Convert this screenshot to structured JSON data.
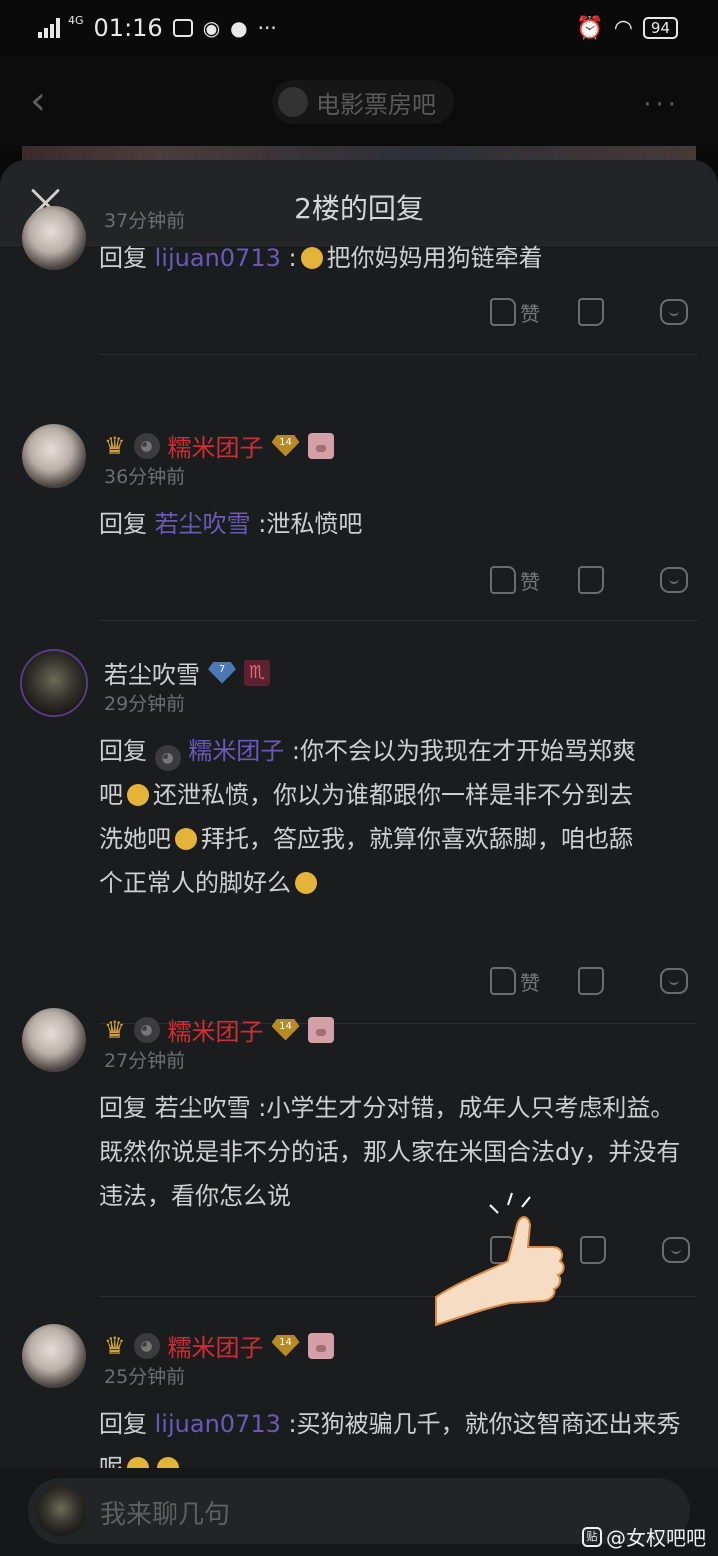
{
  "status_bar": {
    "network": "4G",
    "time": "01:16",
    "battery": "94"
  },
  "nav": {
    "back_icon": "chevron-left-icon",
    "forum_name": "电影票房吧",
    "more": "···"
  },
  "sheet": {
    "title": "2楼的回复",
    "close_icon": "close-icon"
  },
  "replies": [
    {
      "time": "37分钟前",
      "reply_prefix": "回复",
      "reply_target": "lijuan0713",
      "text_before_emoji": " :",
      "text": "把你妈妈用狗链牵着",
      "like_label": "赞"
    },
    {
      "username": "糯米团子",
      "level": "14",
      "time": "36分钟前",
      "reply_prefix": "回复",
      "reply_target": "若尘吹雪",
      "text": " :泄私愤吧",
      "like_label": "赞"
    },
    {
      "username": "若尘吹雪",
      "level": "7",
      "zodiac": "♏",
      "time": "29分钟前",
      "reply_prefix": "回复",
      "reply_target": "糯米团子",
      "text1": " :你不会以为我现在才开始骂郑爽",
      "text2": "吧",
      "text3": "还泄私愤，你以为谁都跟你一样是非不分到去",
      "text4": "洗她吧",
      "text5": "拜托，答应我，就算你喜欢舔脚，咱也舔",
      "text6": "个正常人的脚好么",
      "like_label": "赞"
    },
    {
      "username": "糯米团子",
      "level": "14",
      "time": "27分钟前",
      "text": "回复 若尘吹雪 :小学生才分对错，成年人只考虑利益。既然你说是非不分的话，那人家在米国合法dy，并没有违法，看你怎么说"
    },
    {
      "username": "糯米团子",
      "level": "14",
      "time": "25分钟前",
      "reply_prefix": "回复",
      "reply_target": "lijuan0713",
      "text": " :买狗被骗几千，就你这智商还出来秀呢"
    }
  ],
  "input": {
    "placeholder": "我来聊几句"
  },
  "watermark": {
    "text": "@女权吧吧",
    "icon_text": "贴"
  },
  "colors": {
    "sheet_bg": "#1b1c1e",
    "username_red": "#cf2e34",
    "link_purple": "#6a59b8"
  }
}
